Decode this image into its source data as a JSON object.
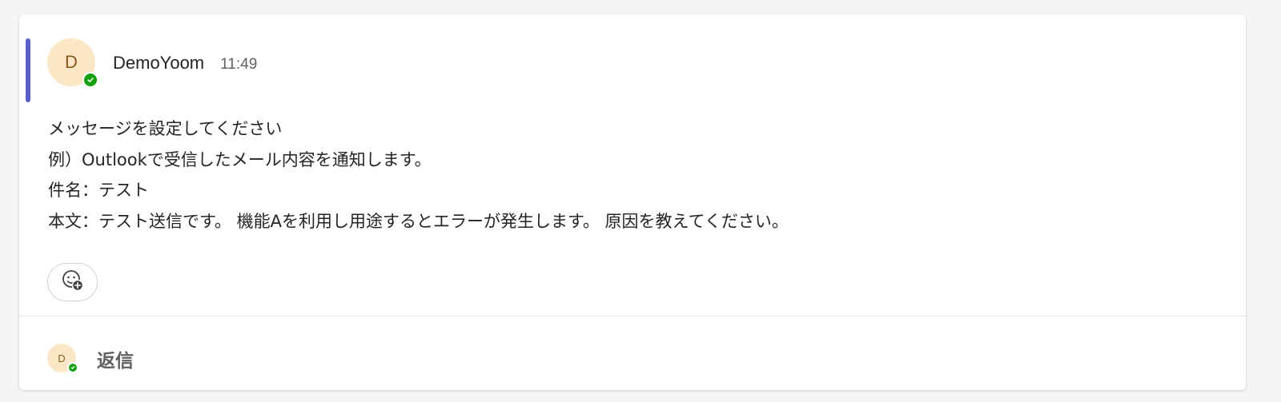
{
  "message": {
    "avatar_initial": "D",
    "sender": "DemoYoom",
    "time": "11:49",
    "presence": "available",
    "body_lines": [
      "メッセージを設定してください",
      "例）Outlookで受信したメール内容を通知します。",
      "件名：テスト",
      "本文：テスト送信です。 機能Aを利用し用途するとエラーが発生します。 原因を教えてください。"
    ],
    "reaction_icon": "add-reaction-icon"
  },
  "reply": {
    "avatar_initial": "D",
    "label": "返信"
  },
  "colors": {
    "accent": "#5b5fc7",
    "avatar_bg": "#fbe6c6",
    "avatar_text": "#8a5a1e",
    "presence": "#13a10e"
  }
}
